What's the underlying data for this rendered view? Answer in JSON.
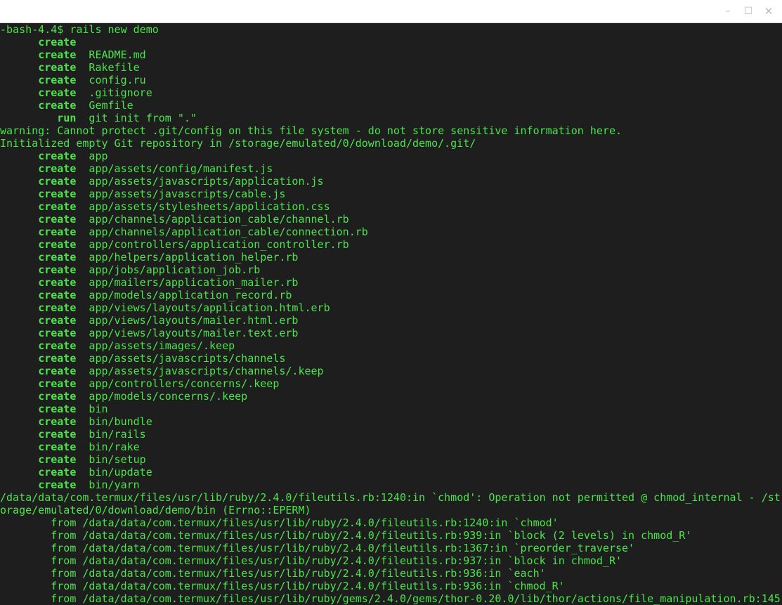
{
  "window": {
    "controls": {
      "minimize": "–",
      "maximize": "☐",
      "close": "✕"
    }
  },
  "terminal": {
    "lines": [
      {
        "indent": "",
        "keyword": "",
        "text": "-bash-4.4$ rails new demo"
      },
      {
        "indent": "      ",
        "keyword": "create",
        "text": ""
      },
      {
        "indent": "      ",
        "keyword": "create",
        "text": "  README.md"
      },
      {
        "indent": "      ",
        "keyword": "create",
        "text": "  Rakefile"
      },
      {
        "indent": "      ",
        "keyword": "create",
        "text": "  config.ru"
      },
      {
        "indent": "      ",
        "keyword": "create",
        "text": "  .gitignore"
      },
      {
        "indent": "      ",
        "keyword": "create",
        "text": "  Gemfile"
      },
      {
        "indent": "         ",
        "keyword": "run",
        "text": "  git init from \".\""
      },
      {
        "indent": "",
        "keyword": "",
        "text": "warning: Cannot protect .git/config on this file system - do not store sensitive information here."
      },
      {
        "indent": "",
        "keyword": "",
        "text": "Initialized empty Git repository in /storage/emulated/0/download/demo/.git/"
      },
      {
        "indent": "      ",
        "keyword": "create",
        "text": "  app"
      },
      {
        "indent": "      ",
        "keyword": "create",
        "text": "  app/assets/config/manifest.js"
      },
      {
        "indent": "      ",
        "keyword": "create",
        "text": "  app/assets/javascripts/application.js"
      },
      {
        "indent": "      ",
        "keyword": "create",
        "text": "  app/assets/javascripts/cable.js"
      },
      {
        "indent": "      ",
        "keyword": "create",
        "text": "  app/assets/stylesheets/application.css"
      },
      {
        "indent": "      ",
        "keyword": "create",
        "text": "  app/channels/application_cable/channel.rb"
      },
      {
        "indent": "      ",
        "keyword": "create",
        "text": "  app/channels/application_cable/connection.rb"
      },
      {
        "indent": "      ",
        "keyword": "create",
        "text": "  app/controllers/application_controller.rb"
      },
      {
        "indent": "      ",
        "keyword": "create",
        "text": "  app/helpers/application_helper.rb"
      },
      {
        "indent": "      ",
        "keyword": "create",
        "text": "  app/jobs/application_job.rb"
      },
      {
        "indent": "      ",
        "keyword": "create",
        "text": "  app/mailers/application_mailer.rb"
      },
      {
        "indent": "      ",
        "keyword": "create",
        "text": "  app/models/application_record.rb"
      },
      {
        "indent": "      ",
        "keyword": "create",
        "text": "  app/views/layouts/application.html.erb"
      },
      {
        "indent": "      ",
        "keyword": "create",
        "text": "  app/views/layouts/mailer.html.erb"
      },
      {
        "indent": "      ",
        "keyword": "create",
        "text": "  app/views/layouts/mailer.text.erb"
      },
      {
        "indent": "      ",
        "keyword": "create",
        "text": "  app/assets/images/.keep"
      },
      {
        "indent": "      ",
        "keyword": "create",
        "text": "  app/assets/javascripts/channels"
      },
      {
        "indent": "      ",
        "keyword": "create",
        "text": "  app/assets/javascripts/channels/.keep"
      },
      {
        "indent": "      ",
        "keyword": "create",
        "text": "  app/controllers/concerns/.keep"
      },
      {
        "indent": "      ",
        "keyword": "create",
        "text": "  app/models/concerns/.keep"
      },
      {
        "indent": "      ",
        "keyword": "create",
        "text": "  bin"
      },
      {
        "indent": "      ",
        "keyword": "create",
        "text": "  bin/bundle"
      },
      {
        "indent": "      ",
        "keyword": "create",
        "text": "  bin/rails"
      },
      {
        "indent": "      ",
        "keyword": "create",
        "text": "  bin/rake"
      },
      {
        "indent": "      ",
        "keyword": "create",
        "text": "  bin/setup"
      },
      {
        "indent": "      ",
        "keyword": "create",
        "text": "  bin/update"
      },
      {
        "indent": "      ",
        "keyword": "create",
        "text": "  bin/yarn"
      },
      {
        "indent": "",
        "keyword": "",
        "text": "/data/data/com.termux/files/usr/lib/ruby/2.4.0/fileutils.rb:1240:in `chmod': Operation not permitted @ chmod_internal - /st"
      },
      {
        "indent": "",
        "keyword": "",
        "text": "orage/emulated/0/download/demo/bin (Errno::EPERM)"
      },
      {
        "indent": "        ",
        "keyword": "",
        "text": "from /data/data/com.termux/files/usr/lib/ruby/2.4.0/fileutils.rb:1240:in `chmod'"
      },
      {
        "indent": "        ",
        "keyword": "",
        "text": "from /data/data/com.termux/files/usr/lib/ruby/2.4.0/fileutils.rb:939:in `block (2 levels) in chmod_R'"
      },
      {
        "indent": "        ",
        "keyword": "",
        "text": "from /data/data/com.termux/files/usr/lib/ruby/2.4.0/fileutils.rb:1367:in `preorder_traverse'"
      },
      {
        "indent": "        ",
        "keyword": "",
        "text": "from /data/data/com.termux/files/usr/lib/ruby/2.4.0/fileutils.rb:937:in `block in chmod_R'"
      },
      {
        "indent": "        ",
        "keyword": "",
        "text": "from /data/data/com.termux/files/usr/lib/ruby/2.4.0/fileutils.rb:936:in `each'"
      },
      {
        "indent": "        ",
        "keyword": "",
        "text": "from /data/data/com.termux/files/usr/lib/ruby/2.4.0/fileutils.rb:936:in `chmod_R'"
      },
      {
        "indent": "        ",
        "keyword": "",
        "text": "from /data/data/com.termux/files/usr/lib/ruby/gems/2.4.0/gems/thor-0.20.0/lib/thor/actions/file_manipulation.rb:145"
      }
    ]
  },
  "colors": {
    "terminal_background": "#1e1e1e",
    "terminal_text": "#4be44b",
    "titlebar_background": "#ffffff"
  }
}
